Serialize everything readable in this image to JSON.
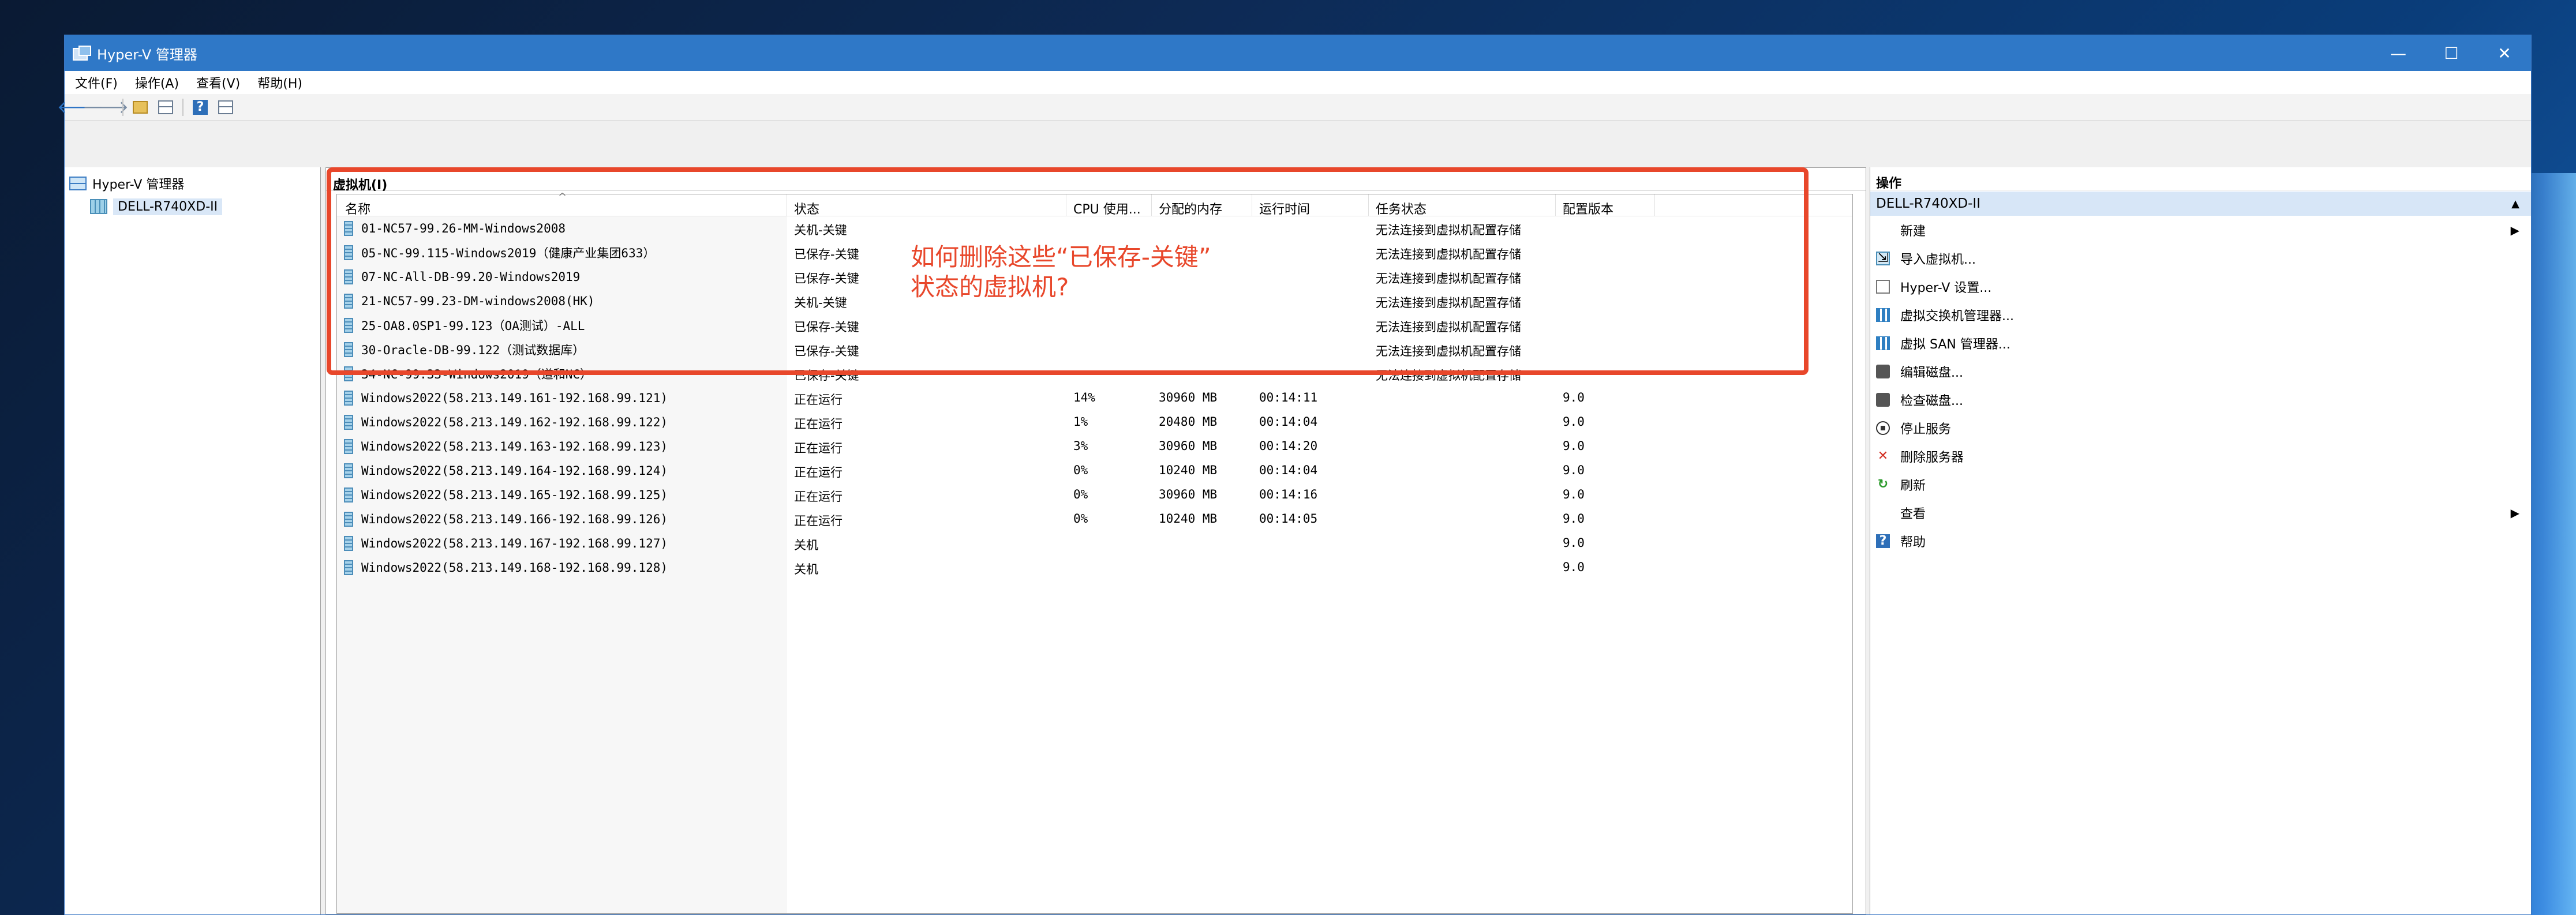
{
  "window": {
    "title": "Hyper-V 管理器",
    "controls": [
      "—",
      "☐",
      "✕"
    ]
  },
  "menu": [
    "文件(F)",
    "操作(A)",
    "查看(V)",
    "帮助(H)"
  ],
  "tree": {
    "root": "Hyper-V 管理器",
    "server": "DELL-R740XD-II"
  },
  "vm_section": {
    "title": "虚拟机(I)"
  },
  "columns": [
    "名称",
    "状态",
    "CPU 使用...",
    "分配的内存",
    "运行时间",
    "任务状态",
    "配置版本"
  ],
  "vms": [
    {
      "name": "01-NC57-99.26-MM-Windows2008",
      "state": "关机-关键",
      "cpu": "",
      "mem": "",
      "uptime": "",
      "task": "无法连接到虚拟机配置存储",
      "version": ""
    },
    {
      "name": "05-NC-99.115-Windows2019（健康产业集团633）",
      "state": "已保存-关键",
      "cpu": "",
      "mem": "",
      "uptime": "",
      "task": "无法连接到虚拟机配置存储",
      "version": ""
    },
    {
      "name": "07-NC-All-DB-99.20-Windows2019",
      "state": "已保存-关键",
      "cpu": "",
      "mem": "",
      "uptime": "",
      "task": "无法连接到虚拟机配置存储",
      "version": ""
    },
    {
      "name": "21-NC57-99.23-DM-windows2008(HK)",
      "state": "关机-关键",
      "cpu": "",
      "mem": "",
      "uptime": "",
      "task": "无法连接到虚拟机配置存储",
      "version": ""
    },
    {
      "name": "25-OA8.0SP1-99.123（OA测试）-ALL",
      "state": "已保存-关键",
      "cpu": "",
      "mem": "",
      "uptime": "",
      "task": "无法连接到虚拟机配置存储",
      "version": ""
    },
    {
      "name": "30-Oracle-DB-99.122（测试数据库）",
      "state": "已保存-关键",
      "cpu": "",
      "mem": "",
      "uptime": "",
      "task": "无法连接到虚拟机配置存储",
      "version": ""
    },
    {
      "name": "34-NC-99.33-Windows2019（道和NC）",
      "state": "已保存-关键",
      "cpu": "",
      "mem": "",
      "uptime": "",
      "task": "无法连接到虚拟机配置存储",
      "version": ""
    },
    {
      "name": "Windows2022(58.213.149.161-192.168.99.121)",
      "state": "正在运行",
      "cpu": "14%",
      "mem": "30960 MB",
      "uptime": "00:14:11",
      "task": "",
      "version": "9.0"
    },
    {
      "name": "Windows2022(58.213.149.162-192.168.99.122)",
      "state": "正在运行",
      "cpu": "1%",
      "mem": "20480 MB",
      "uptime": "00:14:04",
      "task": "",
      "version": "9.0"
    },
    {
      "name": "Windows2022(58.213.149.163-192.168.99.123)",
      "state": "正在运行",
      "cpu": "3%",
      "mem": "30960 MB",
      "uptime": "00:14:20",
      "task": "",
      "version": "9.0"
    },
    {
      "name": "Windows2022(58.213.149.164-192.168.99.124)",
      "state": "正在运行",
      "cpu": "0%",
      "mem": "10240 MB",
      "uptime": "00:14:04",
      "task": "",
      "version": "9.0"
    },
    {
      "name": "Windows2022(58.213.149.165-192.168.99.125)",
      "state": "正在运行",
      "cpu": "0%",
      "mem": "30960 MB",
      "uptime": "00:14:16",
      "task": "",
      "version": "9.0"
    },
    {
      "name": "Windows2022(58.213.149.166-192.168.99.126)",
      "state": "正在运行",
      "cpu": "0%",
      "mem": "10240 MB",
      "uptime": "00:14:05",
      "task": "",
      "version": "9.0"
    },
    {
      "name": "Windows2022(58.213.149.167-192.168.99.127)",
      "state": "关机",
      "cpu": "",
      "mem": "",
      "uptime": "",
      "task": "",
      "version": "9.0"
    },
    {
      "name": "Windows2022(58.213.149.168-192.168.99.128)",
      "state": "关机",
      "cpu": "",
      "mem": "",
      "uptime": "",
      "task": "",
      "version": "9.0"
    }
  ],
  "annotation": {
    "text": "如何删除这些“已保存-关键”\n状态的虚拟机?",
    "color": "#e8472b"
  },
  "actions": {
    "title": "操作",
    "group": "DELL-R740XD-II",
    "items": [
      {
        "label": "新建",
        "icon": "none",
        "submenu": true
      },
      {
        "label": "导入虚拟机...",
        "icon": "import-vm-icon"
      },
      {
        "label": "Hyper-V 设置...",
        "icon": "settings-doc-icon"
      },
      {
        "label": "虚拟交换机管理器...",
        "icon": "virtual-switch-icon"
      },
      {
        "label": "虚拟 SAN 管理器...",
        "icon": "virtual-san-icon"
      },
      {
        "label": "编辑磁盘...",
        "icon": "edit-disk-icon"
      },
      {
        "label": "检查磁盘...",
        "icon": "inspect-disk-icon"
      },
      {
        "label": "停止服务",
        "icon": "stop-service-icon"
      },
      {
        "label": "删除服务器",
        "icon": "delete-icon"
      },
      {
        "label": "刷新",
        "icon": "refresh-icon"
      },
      {
        "label": "查看",
        "icon": "none",
        "submenu": true
      },
      {
        "label": "帮助",
        "icon": "help-icon"
      }
    ]
  }
}
